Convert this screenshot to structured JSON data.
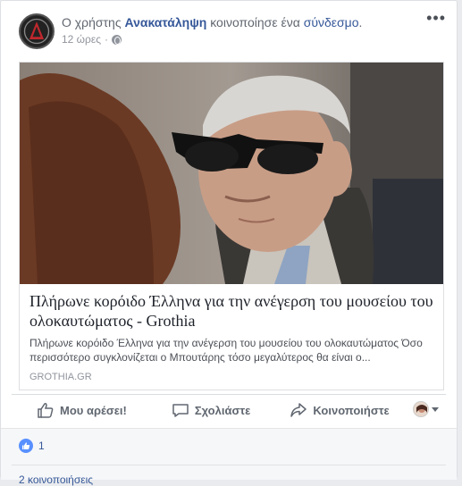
{
  "post": {
    "prefix": "Ο χρήστης",
    "author": "Ανακατάληψη",
    "action_text": "κοινοποίησε ένα",
    "link_word": "σύνδεσμο",
    "period": ".",
    "timestamp": "12 ώρες",
    "separator": "·",
    "audience_icon": "globe-icon",
    "more_label": "•••"
  },
  "link_preview": {
    "title": "Πλήρωνε κορόιδο Έλληνα για την ανέγερση του μουσείου του ολοκαυτώματος - Grothia",
    "description": "Πλήρωνε κορόιδο Έλληνα για την ανέγερση του μουσείου του ολοκαυτώματος Όσο περισσότερο συγκλονίζεται ο Μπουτάρης τόσο μεγαλύτερος θα είναι ο...",
    "domain": "GROTHIA.GR"
  },
  "actions": {
    "like": "Μου αρέσει!",
    "comment": "Σχολιάστε",
    "share": "Κοινοποιήστε"
  },
  "reactions": {
    "like_count": "1",
    "shares": "2 κοινοποιήσεις"
  },
  "colors": {
    "link": "#365899",
    "like_badge": "#5890ff",
    "action_text": "#606770"
  }
}
